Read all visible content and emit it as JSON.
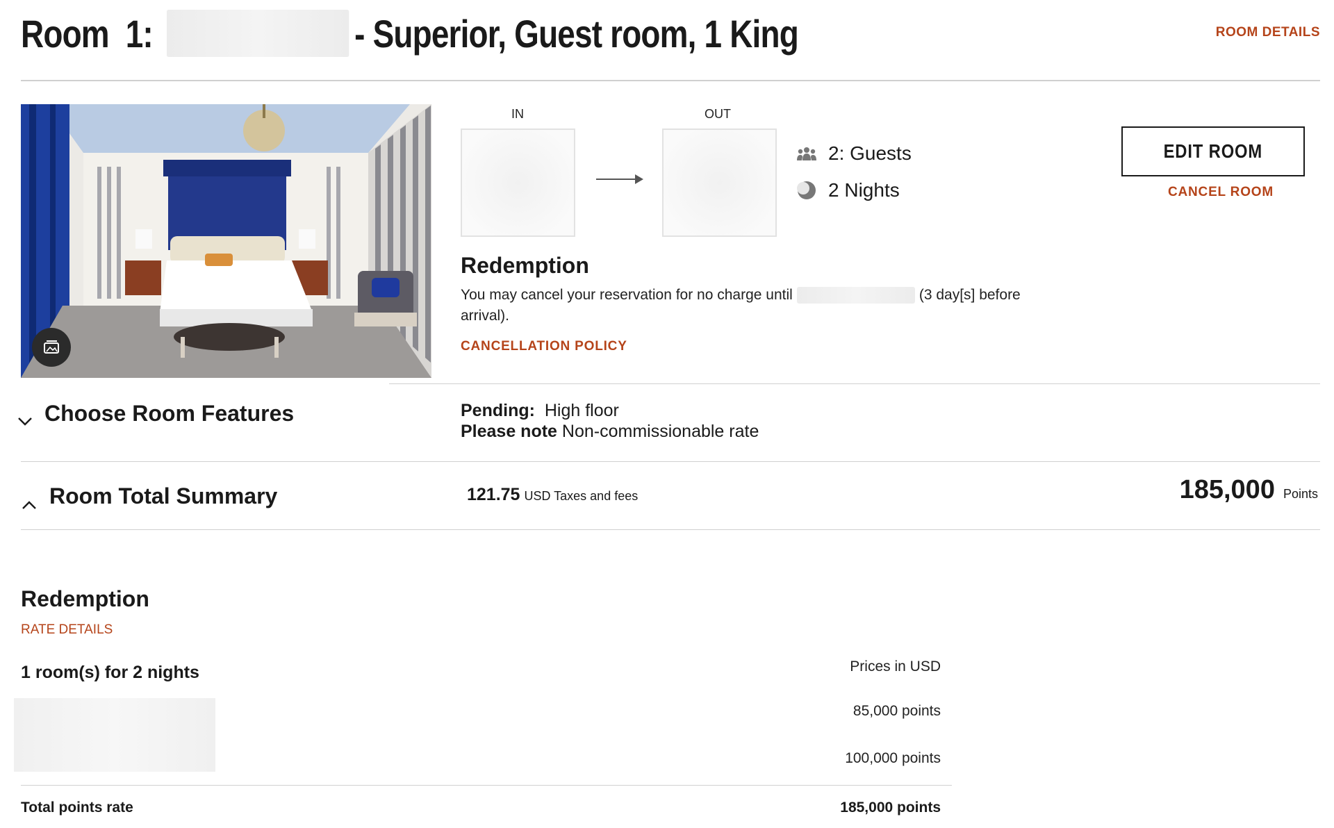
{
  "header": {
    "title_prefix": "Room  1:",
    "title_suffix": "- Superior, Guest room, 1 King",
    "room_details_link": "ROOM DETAILS"
  },
  "stay": {
    "in_label": "IN",
    "out_label": "OUT",
    "guests": "2: Guests",
    "nights": "2 Nights"
  },
  "actions": {
    "edit_room": "EDIT ROOM",
    "cancel_room": "CANCEL ROOM"
  },
  "redemption": {
    "heading": "Redemption",
    "cancel_text_before": "You may cancel your reservation for no charge until",
    "cancel_text_after": "(3 day[s] before arrival).",
    "cancellation_policy": "CANCELLATION POLICY"
  },
  "features": {
    "heading": "Choose Room Features",
    "pending_label": "Pending:",
    "pending_value": "High floor",
    "note_label": "Please note",
    "note_value": "Non-commissionable rate"
  },
  "summary": {
    "heading": "Room Total Summary",
    "taxes_amount": "121.75",
    "taxes_label": "USD Taxes and fees",
    "points_amount": "185,000",
    "points_label": "Points"
  },
  "rate": {
    "heading": "Redemption",
    "rate_details": "RATE DETAILS",
    "rooms_nights": "1 room(s) for 2 nights",
    "prices_in": "Prices in USD",
    "night1": "85,000 points",
    "night2": "100,000 points",
    "total_label": "Total points rate",
    "total_value": "185,000 points"
  },
  "icons": {
    "gallery": "gallery-icon",
    "arrow": "arrow-right-icon",
    "guests": "guests-icon",
    "nights": "moon-icon",
    "chevron_down": "chevron-down-icon",
    "chevron_up": "chevron-up-icon"
  },
  "colors": {
    "accent": "#b5441a",
    "text": "#1a1a1a",
    "divider": "#d0d0d0"
  }
}
